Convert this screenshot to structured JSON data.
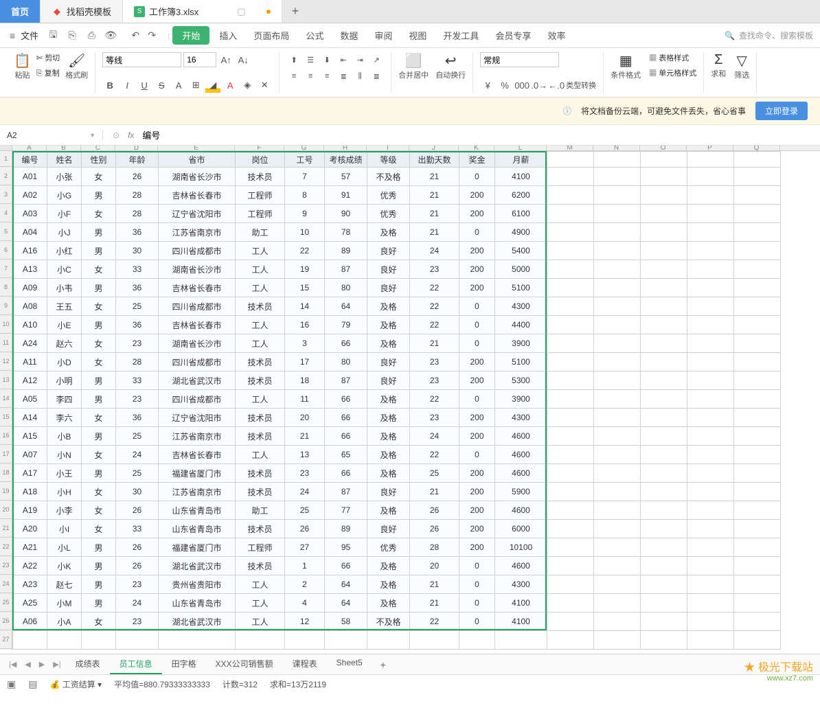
{
  "tabs": {
    "home": "首页",
    "template": "找稻壳模板",
    "workbook": "工作簿3.xlsx"
  },
  "menu": {
    "file": "文件",
    "items": [
      "开始",
      "插入",
      "页面布局",
      "公式",
      "数据",
      "审阅",
      "视图",
      "开发工具",
      "会员专享",
      "效率"
    ],
    "search_placeholder": "查找命令、搜索模板"
  },
  "ribbon": {
    "paste": "粘贴",
    "cut": "剪切",
    "copy": "复制",
    "painter": "格式刷",
    "font": "等线",
    "size": "16",
    "merge": "合并居中",
    "wrap": "自动换行",
    "numfmt": "常规",
    "typeconv": "类型转换",
    "condfmt": "条件格式",
    "tablestyle": "表格样式",
    "cellstyle": "单元格样式",
    "sum": "求和",
    "filter": "筛选"
  },
  "banner": {
    "text": "将文档备份云端，可避免文件丢失，省心省事",
    "btn": "立即登录"
  },
  "namebox": "A2",
  "formula": "编号",
  "columns_ext": [
    "M",
    "N",
    "O",
    "P",
    "Q"
  ],
  "headers": [
    "编号",
    "姓名",
    "性别",
    "年龄",
    "省市",
    "岗位",
    "工号",
    "考核成绩",
    "等级",
    "出勤天数",
    "奖金",
    "月薪"
  ],
  "rows": [
    [
      "A01",
      "小张",
      "女",
      "26",
      "湖南省长沙市",
      "技术员",
      "7",
      "57",
      "不及格",
      "21",
      "0",
      "4100"
    ],
    [
      "A02",
      "小G",
      "男",
      "28",
      "吉林省长春市",
      "工程师",
      "8",
      "91",
      "优秀",
      "21",
      "200",
      "6200"
    ],
    [
      "A03",
      "小F",
      "女",
      "28",
      "辽宁省沈阳市",
      "工程师",
      "9",
      "90",
      "优秀",
      "21",
      "200",
      "6100"
    ],
    [
      "A04",
      "小J",
      "男",
      "36",
      "江苏省南京市",
      "助工",
      "10",
      "78",
      "及格",
      "21",
      "0",
      "4900"
    ],
    [
      "A16",
      "小红",
      "男",
      "30",
      "四川省成都市",
      "工人",
      "22",
      "89",
      "良好",
      "24",
      "200",
      "5400"
    ],
    [
      "A13",
      "小C",
      "女",
      "33",
      "湖南省长沙市",
      "工人",
      "19",
      "87",
      "良好",
      "23",
      "200",
      "5000"
    ],
    [
      "A09",
      "小韦",
      "男",
      "36",
      "吉林省长春市",
      "工人",
      "15",
      "80",
      "良好",
      "22",
      "200",
      "5100"
    ],
    [
      "A08",
      "王五",
      "女",
      "25",
      "四川省成都市",
      "技术员",
      "14",
      "64",
      "及格",
      "22",
      "0",
      "4300"
    ],
    [
      "A10",
      "小E",
      "男",
      "36",
      "吉林省长春市",
      "工人",
      "16",
      "79",
      "及格",
      "22",
      "0",
      "4400"
    ],
    [
      "A24",
      "赵六",
      "女",
      "23",
      "湖南省长沙市",
      "工人",
      "3",
      "66",
      "及格",
      "21",
      "0",
      "3900"
    ],
    [
      "A11",
      "小D",
      "女",
      "28",
      "四川省成都市",
      "技术员",
      "17",
      "80",
      "良好",
      "23",
      "200",
      "5100"
    ],
    [
      "A12",
      "小明",
      "男",
      "33",
      "湖北省武汉市",
      "技术员",
      "18",
      "87",
      "良好",
      "23",
      "200",
      "5300"
    ],
    [
      "A05",
      "李四",
      "男",
      "23",
      "四川省成都市",
      "工人",
      "11",
      "66",
      "及格",
      "22",
      "0",
      "3900"
    ],
    [
      "A14",
      "李六",
      "女",
      "36",
      "辽宁省沈阳市",
      "技术员",
      "20",
      "66",
      "及格",
      "23",
      "200",
      "4300"
    ],
    [
      "A15",
      "小B",
      "男",
      "25",
      "江苏省南京市",
      "技术员",
      "21",
      "66",
      "及格",
      "24",
      "200",
      "4600"
    ],
    [
      "A07",
      "小N",
      "女",
      "24",
      "吉林省长春市",
      "工人",
      "13",
      "65",
      "及格",
      "22",
      "0",
      "4600"
    ],
    [
      "A17",
      "小王",
      "男",
      "25",
      "福建省厦门市",
      "技术员",
      "23",
      "66",
      "及格",
      "25",
      "200",
      "4600"
    ],
    [
      "A18",
      "小H",
      "女",
      "30",
      "江苏省南京市",
      "技术员",
      "24",
      "87",
      "良好",
      "21",
      "200",
      "5900"
    ],
    [
      "A19",
      "小李",
      "女",
      "26",
      "山东省青岛市",
      "助工",
      "25",
      "77",
      "及格",
      "26",
      "200",
      "4600"
    ],
    [
      "A20",
      "小I",
      "女",
      "33",
      "山东省青岛市",
      "技术员",
      "26",
      "89",
      "良好",
      "26",
      "200",
      "6000"
    ],
    [
      "A21",
      "小L",
      "男",
      "26",
      "福建省厦门市",
      "工程师",
      "27",
      "95",
      "优秀",
      "28",
      "200",
      "10100"
    ],
    [
      "A22",
      "小K",
      "男",
      "26",
      "湖北省武汉市",
      "技术员",
      "1",
      "66",
      "及格",
      "20",
      "0",
      "4600"
    ],
    [
      "A23",
      "赵七",
      "男",
      "23",
      "贵州省贵阳市",
      "工人",
      "2",
      "64",
      "及格",
      "21",
      "0",
      "4300"
    ],
    [
      "A25",
      "小M",
      "男",
      "24",
      "山东省青岛市",
      "工人",
      "4",
      "64",
      "及格",
      "21",
      "0",
      "4100"
    ],
    [
      "A06",
      "小A",
      "女",
      "23",
      "湖北省武汉市",
      "工人",
      "12",
      "58",
      "不及格",
      "22",
      "0",
      "4100"
    ]
  ],
  "sheet_tabs": [
    "成绩表",
    "员工信息",
    "田字格",
    "XXX公司销售额",
    "课程表",
    "Sheet5"
  ],
  "active_sheet": 1,
  "status": {
    "calc": "工资结算",
    "avg": "平均值=880.79333333333",
    "count": "计数=312",
    "sum": "求和=13万2119"
  },
  "watermark": {
    "l1": "极光下载站",
    "l2": "www.xz7.com"
  }
}
